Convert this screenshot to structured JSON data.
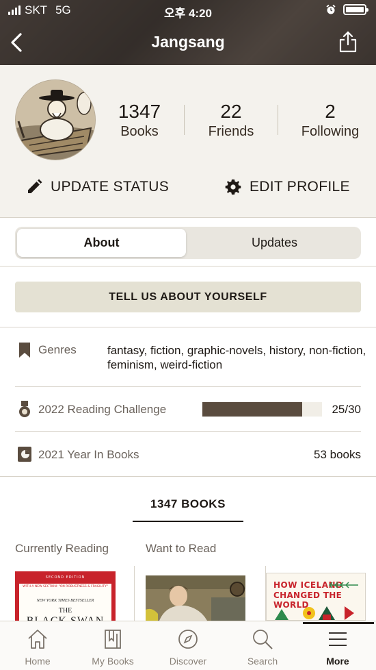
{
  "status_bar": {
    "carrier": "SKT",
    "network": "5G",
    "time": "오후 4:20"
  },
  "nav": {
    "title": "Jangsang"
  },
  "profile": {
    "stats": [
      {
        "value": "1347",
        "label": "Books"
      },
      {
        "value": "22",
        "label": "Friends"
      },
      {
        "value": "2",
        "label": "Following"
      }
    ],
    "update_status_label": "UPDATE STATUS",
    "edit_profile_label": "EDIT PROFILE"
  },
  "segment": {
    "tabs": [
      "About",
      "Updates"
    ],
    "selected": "About"
  },
  "about": {
    "tell_button": "TELL US ABOUT YOURSELF",
    "genres": {
      "label": "Genres",
      "value": "fantasy, fiction, graphic-novels, history, non-fiction, feminism, weird-fiction"
    },
    "challenge": {
      "label": "2022 Reading Challenge",
      "value": "25/30",
      "progress": 0.833
    },
    "year": {
      "label": "2021 Year In Books",
      "value": "53 books"
    }
  },
  "books_tab": {
    "label": "1347 BOOKS"
  },
  "shelves": [
    "Currently Reading",
    "Want to Read"
  ],
  "covers": [
    {
      "edition": "SECOND EDITION",
      "subtitle": "WITH A NEW SECTION: \"ON ROBUSTNESS & FRAGILITY\"",
      "tag": "NEW YORK TIMES BESTSELLER",
      "pre": "THE",
      "title": "BLACK SWAN"
    },
    {
      "title": ""
    },
    {
      "title_line1": "HOW ICELAND",
      "title_line2": "CHANGED THE WORLD"
    }
  ],
  "tabbar": {
    "items": [
      {
        "label": "Home",
        "icon": "home-icon"
      },
      {
        "label": "My Books",
        "icon": "books-icon"
      },
      {
        "label": "Discover",
        "icon": "compass-icon"
      },
      {
        "label": "Search",
        "icon": "search-icon"
      },
      {
        "label": "More",
        "icon": "menu-icon"
      }
    ],
    "active": "More"
  },
  "colors": {
    "accent": "#5a4c3f",
    "tell_bg": "#e4e1d3",
    "profile_bg": "#f4f2ed"
  }
}
